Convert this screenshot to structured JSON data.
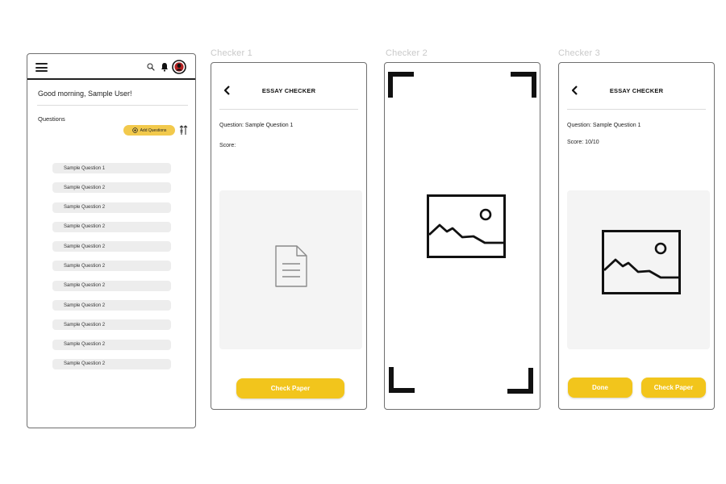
{
  "home": {
    "greeting": "Good morning, Sample User!",
    "questions_label": "Questions",
    "add_questions_label": "Add Questions",
    "questions": [
      "Sample Question 1",
      "Sample Question 2",
      "Sample Question 2",
      "Sample Question 2",
      "Sample Question 2",
      "Sample Question 2",
      "Sample Question 2",
      "Sample Question 2",
      "Sample Question 2",
      "Sample Question 2",
      "Sample Question 2"
    ]
  },
  "checker1": {
    "frame_label": "Checker 1",
    "title": "ESSAY CHECKER",
    "question": "Question: Sample Question 1",
    "score": "Score:",
    "check_paper_label": "Check Paper"
  },
  "checker2": {
    "frame_label": "Checker 2"
  },
  "checker3": {
    "frame_label": "Checker 3",
    "title": "ESSAY CHECKER",
    "question": "Question: Sample Question 1",
    "score": "Score: 10/10",
    "done_label": "Done",
    "check_paper_label": "Check Paper"
  },
  "icons": {
    "menu": "hamburger-menu-icon",
    "search": "search-icon",
    "notification": "bell-icon",
    "profile": "avatar-icon",
    "add": "plus-circle-icon",
    "sort": "sort-icon",
    "back": "chevron-left-icon",
    "document": "document-icon",
    "image": "image-placeholder-icon",
    "scan": "scan-corner-icon"
  },
  "colors": {
    "accent": "#f2c51c",
    "accent_light": "#f2c94c",
    "panel_bg": "#f4f4f4",
    "list_item_bg": "#ededed"
  }
}
